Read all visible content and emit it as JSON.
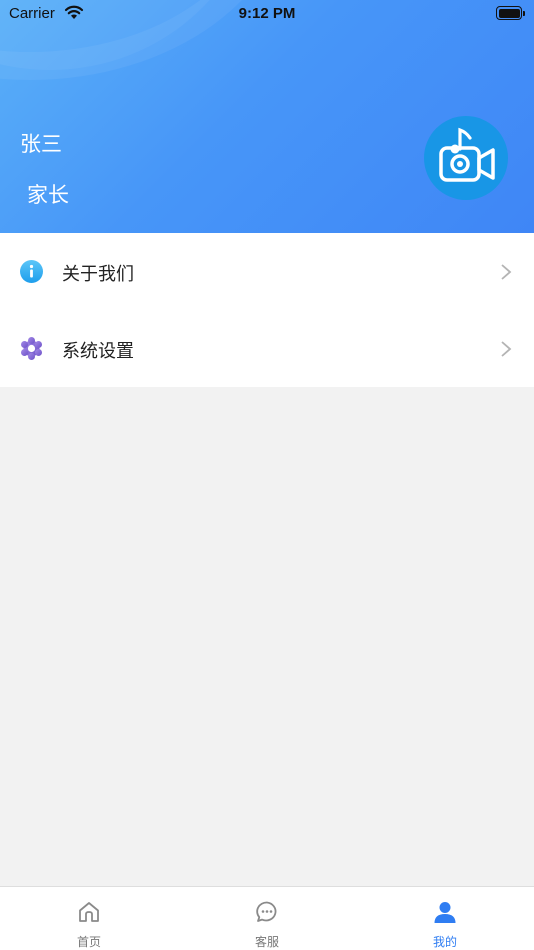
{
  "status_bar": {
    "carrier": "Carrier",
    "time": "9:12 PM"
  },
  "profile": {
    "name": "张三",
    "role": "家长",
    "avatar_icon": "video-camera-music-icon"
  },
  "menu": {
    "items": [
      {
        "label": "关于我们",
        "icon": "info-icon",
        "icon_color": "#2eaaf2"
      },
      {
        "label": "系统设置",
        "icon": "settings-gear-icon",
        "icon_color": "#8a6fd8"
      }
    ]
  },
  "tabbar": {
    "items": [
      {
        "label": "首页",
        "icon": "home-icon",
        "active": false
      },
      {
        "label": "客服",
        "icon": "chat-bubble-icon",
        "active": false
      },
      {
        "label": "我的",
        "icon": "person-icon",
        "active": true
      }
    ]
  },
  "colors": {
    "header_gradient_start": "#5ab0f8",
    "header_gradient_end": "#3f86f6",
    "active_tab": "#2f7df2",
    "background": "#f2f2f2"
  }
}
